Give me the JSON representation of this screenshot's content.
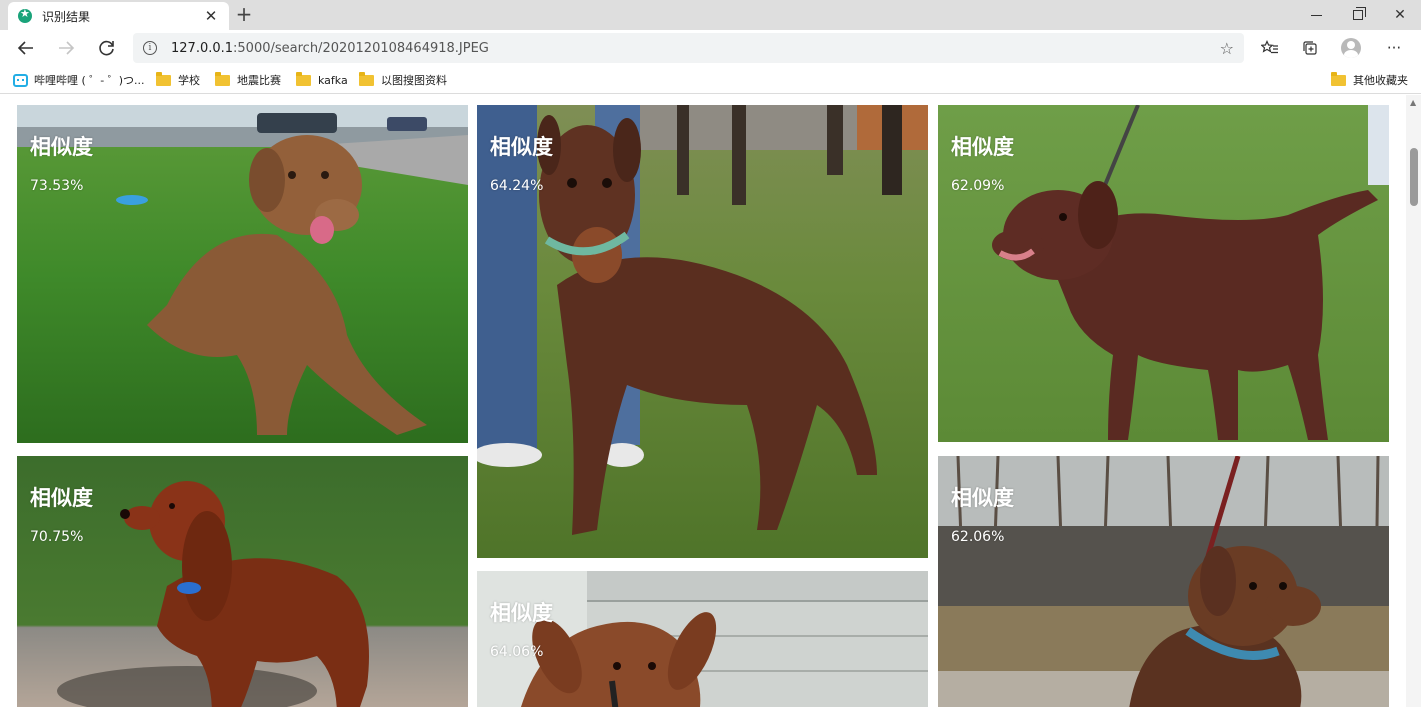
{
  "browser": {
    "tab": {
      "title": "识别结果",
      "favicon": "star-favicon-icon"
    },
    "address": {
      "url_host": "127.0.0.1",
      "url_rest": ":5000/search/2020120108464918.JPEG"
    },
    "bookmarks": [
      {
        "label": "哔哩哔哩 ( ゜- ゜)つ...",
        "icon": "bilibili-icon"
      },
      {
        "label": "学校",
        "icon": "folder-icon"
      },
      {
        "label": "地震比赛",
        "icon": "folder-icon"
      },
      {
        "label": "kafka",
        "icon": "folder-icon"
      },
      {
        "label": "以图搜图资料",
        "icon": "folder-icon"
      }
    ],
    "other_bookmarks": "其他收藏夹"
  },
  "results": [
    {
      "label": "相似度",
      "score": "73.53%"
    },
    {
      "label": "相似度",
      "score": "64.24%"
    },
    {
      "label": "相似度",
      "score": "62.09%"
    },
    {
      "label": "相似度",
      "score": "70.75%"
    },
    {
      "label": "相似度",
      "score": "64.06%"
    },
    {
      "label": "相似度",
      "score": "62.06%"
    }
  ]
}
